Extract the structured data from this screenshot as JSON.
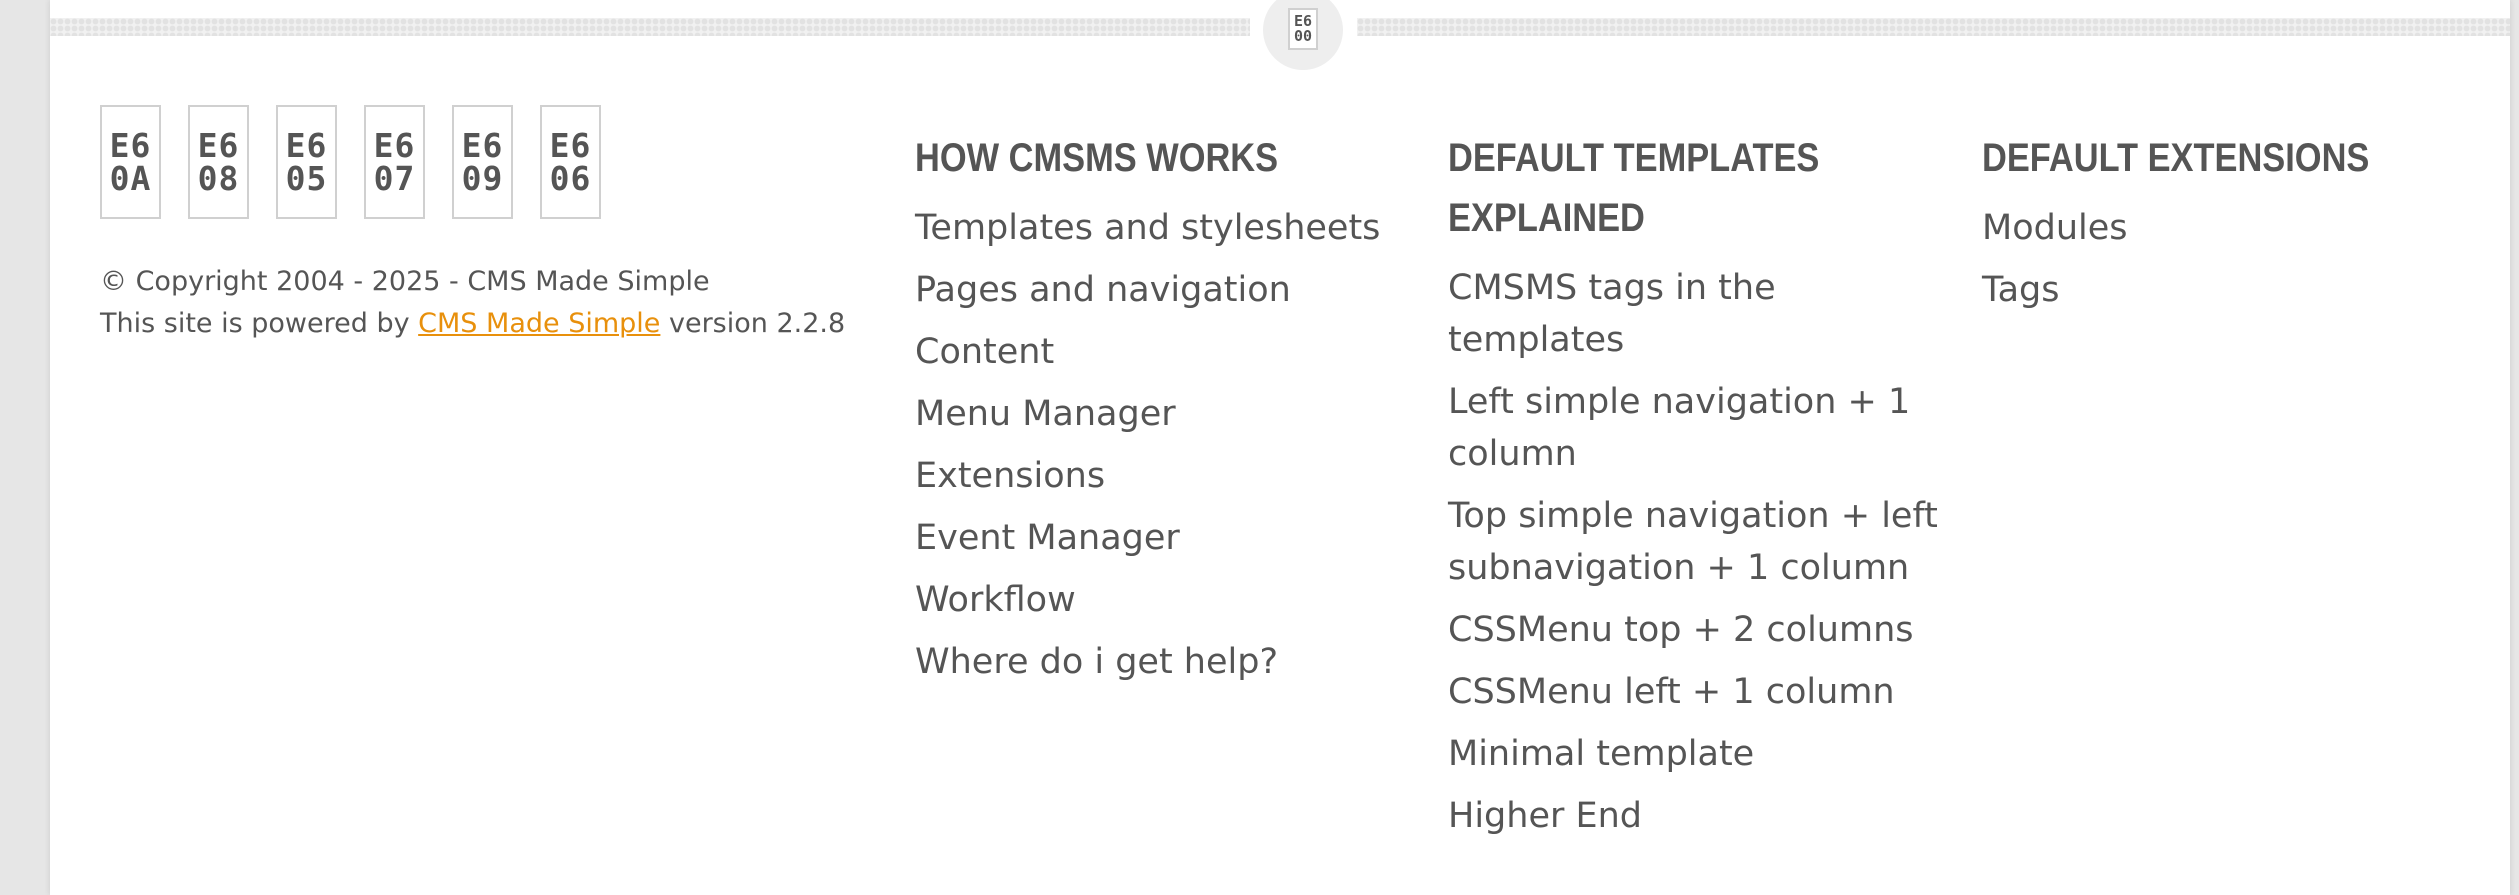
{
  "divider": {
    "scroll_top_icon": "arrow-up-icon",
    "scroll_top_glyph": [
      "E6",
      "00"
    ]
  },
  "social_icons": [
    {
      "name": "facebook-icon",
      "glyph": [
        "E6",
        "0A"
      ]
    },
    {
      "name": "twitter-icon",
      "glyph": [
        "E6",
        "08"
      ]
    },
    {
      "name": "linkedin-icon",
      "glyph": [
        "E6",
        "05"
      ]
    },
    {
      "name": "google-plus-icon",
      "glyph": [
        "E6",
        "07"
      ]
    },
    {
      "name": "youtube-icon",
      "glyph": [
        "E6",
        "09"
      ]
    },
    {
      "name": "rss-icon",
      "glyph": [
        "E6",
        "06"
      ]
    }
  ],
  "copyright": {
    "line1": "© Copyright 2004 - 2025 - CMS Made Simple",
    "powered_prefix": "This site is powered by ",
    "powered_link": "CMS Made Simple",
    "powered_suffix": " version 2.2.8"
  },
  "columns": [
    {
      "heading": "HOW CMSMS WORKS",
      "links": [
        "Templates and stylesheets",
        "Pages and navigation",
        "Content",
        "Menu Manager",
        "Extensions",
        "Event Manager",
        "Workflow",
        "Where do i get help?"
      ]
    },
    {
      "heading": "DEFAULT TEMPLATES EXPLAINED",
      "links": [
        "CMSMS tags in the templates",
        "Left simple navigation + 1 column",
        "Top simple navigation + left subnavigation + 1 column",
        "CSSMenu top + 2 columns",
        "CSSMenu left + 1 column",
        "Minimal template",
        "Higher End"
      ]
    },
    {
      "heading": "DEFAULT EXTENSIONS",
      "links": [
        "Modules",
        "Tags"
      ]
    }
  ],
  "colors": {
    "text": "#555555",
    "link_accent": "#e8900c",
    "background": "#e6e6e6",
    "page": "#ffffff"
  }
}
